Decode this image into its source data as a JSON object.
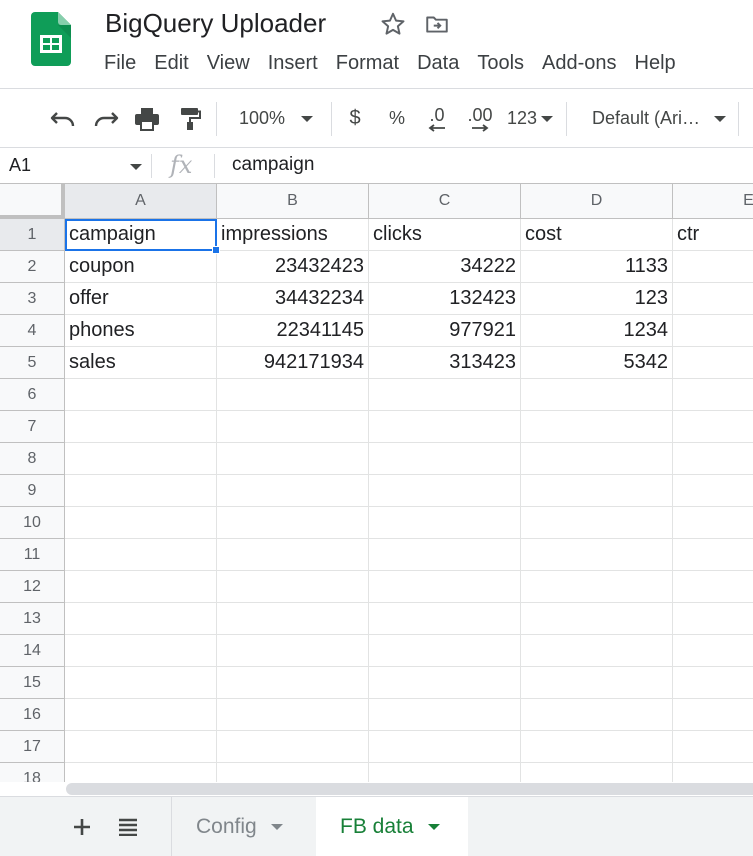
{
  "app": {
    "title": "BigQuery Uploader",
    "brand_color": "#0f9d58",
    "icons": [
      "sheets-logo",
      "star-icon",
      "move-to-folder-icon"
    ]
  },
  "menu": [
    "File",
    "Edit",
    "View",
    "Insert",
    "Format",
    "Data",
    "Tools",
    "Add-ons",
    "Help"
  ],
  "toolbar": {
    "zoom": "100%",
    "currency": "$",
    "percent": "%",
    "decrease_decimal": ".0",
    "increase_decimal": ".00",
    "more_formats": "123",
    "font": "Default (Ari…",
    "icons": [
      "undo-icon",
      "redo-icon",
      "print-icon",
      "paint-format-icon"
    ]
  },
  "formula_bar": {
    "name_box": "A1",
    "fx": "fx",
    "value": "campaign"
  },
  "grid": {
    "columns": [
      "A",
      "B",
      "C",
      "D",
      "E"
    ],
    "row_numbers": [
      "1",
      "2",
      "3",
      "4",
      "5",
      "6",
      "7",
      "8",
      "9",
      "10",
      "11",
      "12",
      "13",
      "14",
      "15",
      "16",
      "17",
      "18"
    ],
    "selected_cell": "A1",
    "rows": [
      [
        "campaign",
        "impressions",
        "clicks",
        "cost",
        "ctr"
      ],
      [
        "coupon",
        "23432423",
        "34222",
        "1133",
        ""
      ],
      [
        "offer",
        "34432234",
        "132423",
        "123",
        ""
      ],
      [
        "phones",
        "22341145",
        "977921",
        "1234",
        ""
      ],
      [
        "sales",
        "942171934",
        "313423",
        "5342",
        ""
      ]
    ],
    "selection_color": "#1a73e8"
  },
  "sheets": {
    "add_icon": "plus-icon",
    "list_icon": "all-sheets-icon",
    "tabs": [
      {
        "label": "Config",
        "active": false
      },
      {
        "label": "FB data",
        "active": true
      }
    ],
    "active_color": "#188038"
  }
}
